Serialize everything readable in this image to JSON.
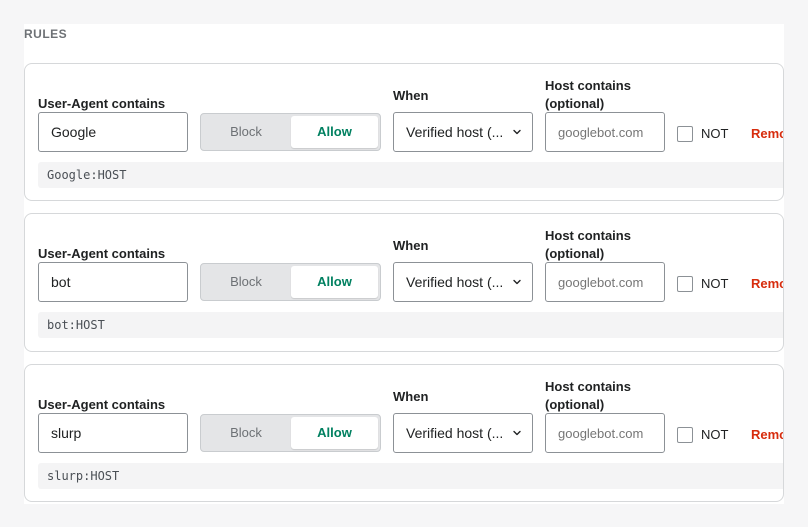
{
  "section": {
    "title": "RULES"
  },
  "labels": {
    "ua": "User-Agent contains",
    "when": "When",
    "host": "Host contains (optional)",
    "not": "NOT",
    "remove": "Remove"
  },
  "segmented": {
    "block": "Block",
    "allow": "Allow",
    "selected": "Allow"
  },
  "host_placeholder": "googlebot.com",
  "rules": [
    {
      "ua_value": "Google",
      "when": "Verified host (...",
      "preview": "Google:HOST",
      "not_checked": false
    },
    {
      "ua_value": "bot",
      "when": "Verified host (...",
      "preview": "bot:HOST",
      "not_checked": false
    },
    {
      "ua_value": "slurp",
      "when": "Verified host (...",
      "preview": "slurp:HOST",
      "not_checked": false
    }
  ],
  "colors": {
    "allow": "#008060",
    "remove": "#d72c0d"
  }
}
